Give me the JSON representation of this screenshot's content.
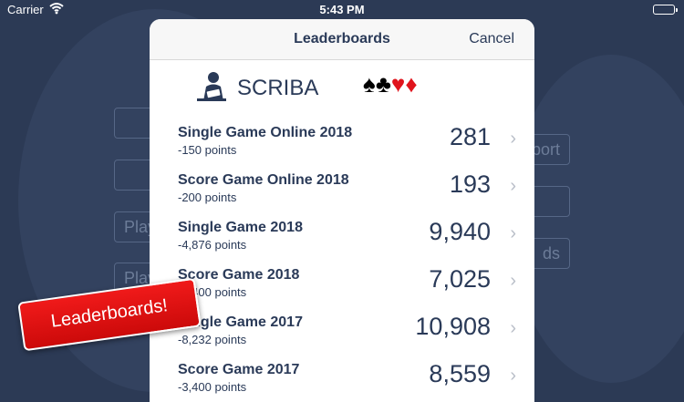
{
  "status_bar": {
    "carrier": "Carrier",
    "time": "5:43 PM",
    "battery_level": 1.0
  },
  "background_buttons": [
    {
      "label": ""
    },
    {
      "label": ""
    },
    {
      "label": "Play"
    },
    {
      "label": "Play"
    },
    {
      "label": "port"
    },
    {
      "label": ""
    },
    {
      "label": "ds"
    }
  ],
  "sheet": {
    "title": "Leaderboards",
    "cancel_label": "Cancel",
    "player": {
      "name": "SCRIBA",
      "suits": [
        "♠",
        "♣",
        "♥",
        "♦"
      ]
    },
    "rows": [
      {
        "title": "Single Game Online 2018",
        "subtitle": "-150 points",
        "score": "281"
      },
      {
        "title": "Score Game Online 2018",
        "subtitle": "-200 points",
        "score": "193"
      },
      {
        "title": "Single Game 2018",
        "subtitle": "-4,876 points",
        "score": "9,940"
      },
      {
        "title": "Score Game 2018",
        "subtitle": "-1,400 points",
        "score": "7,025"
      },
      {
        "title": "Single Game 2017",
        "subtitle": "-8,232 points",
        "score": "10,908"
      },
      {
        "title": "Score Game 2017",
        "subtitle": "-3,400 points",
        "score": "8,559"
      }
    ],
    "chevron": "›"
  },
  "ribbon": {
    "label": "Leaderboards!"
  },
  "colors": {
    "background": "#2c3a55",
    "text": "#2a3a58",
    "ribbon": "#e01414",
    "battery": "#4cd964"
  }
}
